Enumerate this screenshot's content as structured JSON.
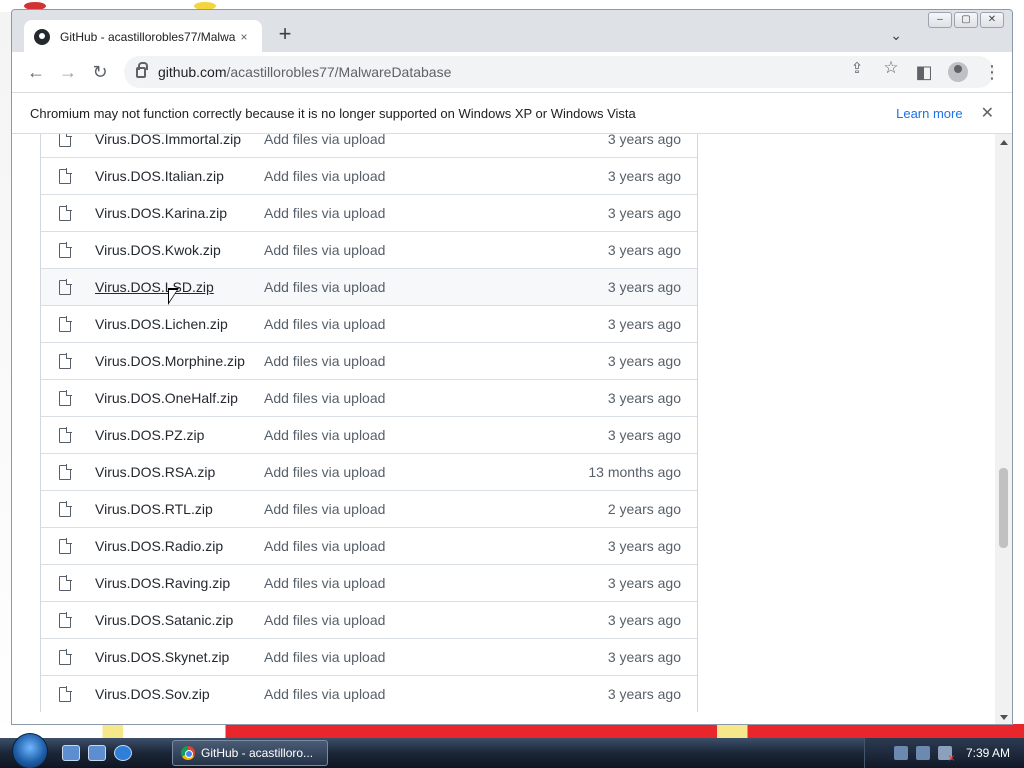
{
  "browser": {
    "tab_title": "GitHub - acastillorobles77/Malwa",
    "tab_close": "×",
    "new_tab": "+",
    "tab_search": "⌄",
    "window_controls": [
      "–",
      "▢",
      "✕"
    ],
    "url_host": "github.com",
    "url_path": "/acastillorobles77/MalwareDatabase",
    "nav": {
      "back": "←",
      "forward": "→",
      "reload": "↻"
    },
    "omni_actions": {
      "share": "⇪",
      "bookmark": "☆"
    },
    "toolbar_actions": {
      "sidepanel": "◧",
      "menu": "⋮"
    }
  },
  "infobar": {
    "message": "Chromium may not function correctly because it is no longer supported on Windows XP or Windows Vista",
    "learn_more": "Learn more",
    "close": "✕"
  },
  "files": [
    {
      "name": "Virus.DOS.Immortal.zip",
      "message": "Add files via upload",
      "age": "3 years ago"
    },
    {
      "name": "Virus.DOS.Italian.zip",
      "message": "Add files via upload",
      "age": "3 years ago"
    },
    {
      "name": "Virus.DOS.Karina.zip",
      "message": "Add files via upload",
      "age": "3 years ago"
    },
    {
      "name": "Virus.DOS.Kwok.zip",
      "message": "Add files via upload",
      "age": "3 years ago"
    },
    {
      "name": "Virus.DOS.LSD.zip",
      "message": "Add files via upload",
      "age": "3 years ago"
    },
    {
      "name": "Virus.DOS.Lichen.zip",
      "message": "Add files via upload",
      "age": "3 years ago"
    },
    {
      "name": "Virus.DOS.Morphine.zip",
      "message": "Add files via upload",
      "age": "3 years ago"
    },
    {
      "name": "Virus.DOS.OneHalf.zip",
      "message": "Add files via upload",
      "age": "3 years ago"
    },
    {
      "name": "Virus.DOS.PZ.zip",
      "message": "Add files via upload",
      "age": "3 years ago"
    },
    {
      "name": "Virus.DOS.RSA.zip",
      "message": "Add files via upload",
      "age": "13 months ago"
    },
    {
      "name": "Virus.DOS.RTL.zip",
      "message": "Add files via upload",
      "age": "2 years ago"
    },
    {
      "name": "Virus.DOS.Radio.zip",
      "message": "Add files via upload",
      "age": "3 years ago"
    },
    {
      "name": "Virus.DOS.Raving.zip",
      "message": "Add files via upload",
      "age": "3 years ago"
    },
    {
      "name": "Virus.DOS.Satanic.zip",
      "message": "Add files via upload",
      "age": "3 years ago"
    },
    {
      "name": "Virus.DOS.Skynet.zip",
      "message": "Add files via upload",
      "age": "3 years ago"
    },
    {
      "name": "Virus.DOS.Sov.zip",
      "message": "Add files via upload",
      "age": "3 years ago"
    }
  ],
  "taskbar": {
    "task_label": "GitHub - acastilloro...",
    "clock": "7:39 AM"
  }
}
